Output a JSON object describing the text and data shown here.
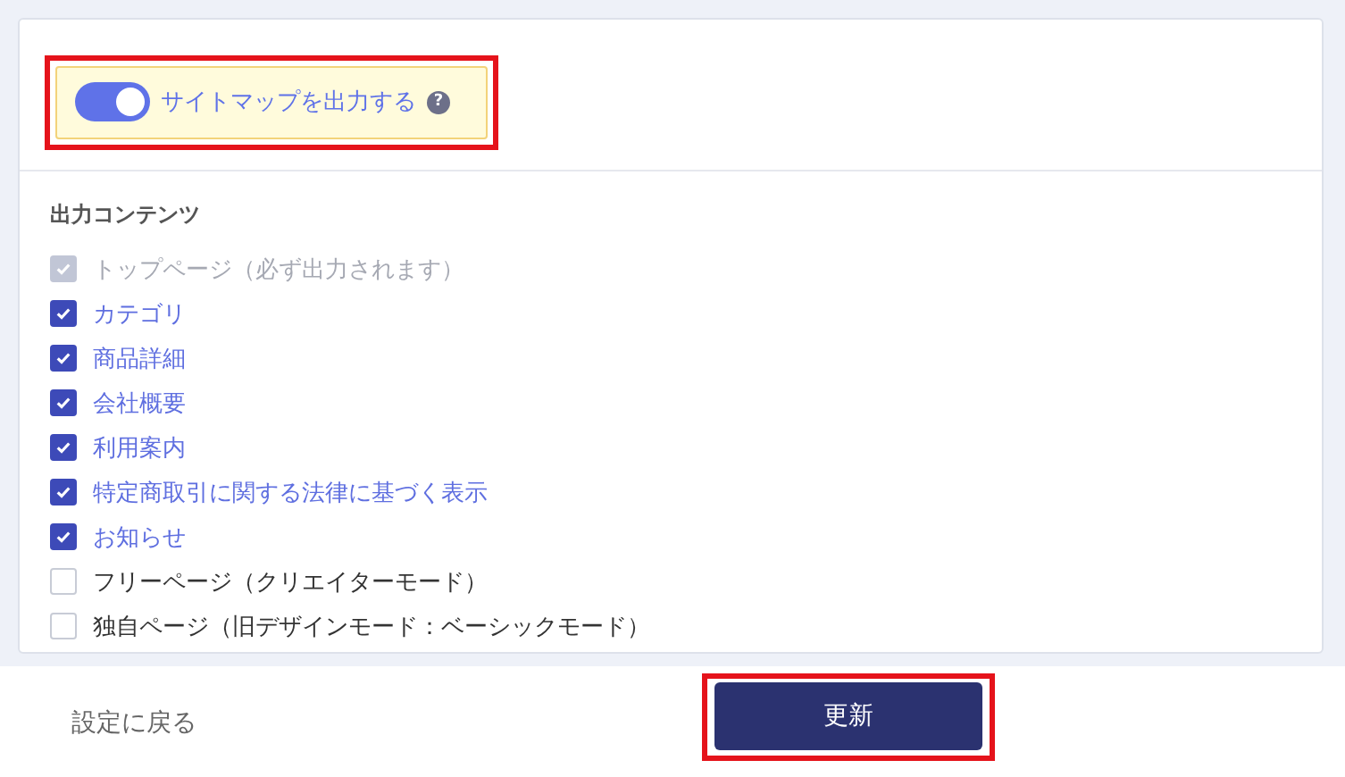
{
  "sitemap_toggle": {
    "label": "サイトマップを出力する",
    "on": true,
    "help_icon": "?",
    "highlighted": true
  },
  "section_title": "出力コンテンツ",
  "contents": [
    {
      "label": "トップページ（必ず出力されます）",
      "checked": true,
      "disabled": true
    },
    {
      "label": "カテゴリ",
      "checked": true,
      "disabled": false
    },
    {
      "label": "商品詳細",
      "checked": true,
      "disabled": false
    },
    {
      "label": "会社概要",
      "checked": true,
      "disabled": false
    },
    {
      "label": "利用案内",
      "checked": true,
      "disabled": false
    },
    {
      "label": "特定商取引に関する法律に基づく表示",
      "checked": true,
      "disabled": false
    },
    {
      "label": "お知らせ",
      "checked": true,
      "disabled": false
    },
    {
      "label": "フリーページ（クリエイターモード）",
      "checked": false,
      "disabled": false
    },
    {
      "label": "独自ページ（旧デザインモード：ベーシックモード）",
      "checked": false,
      "disabled": false
    }
  ],
  "footer": {
    "back_link": "設定に戻る",
    "update_button": "更新",
    "highlighted": true
  }
}
